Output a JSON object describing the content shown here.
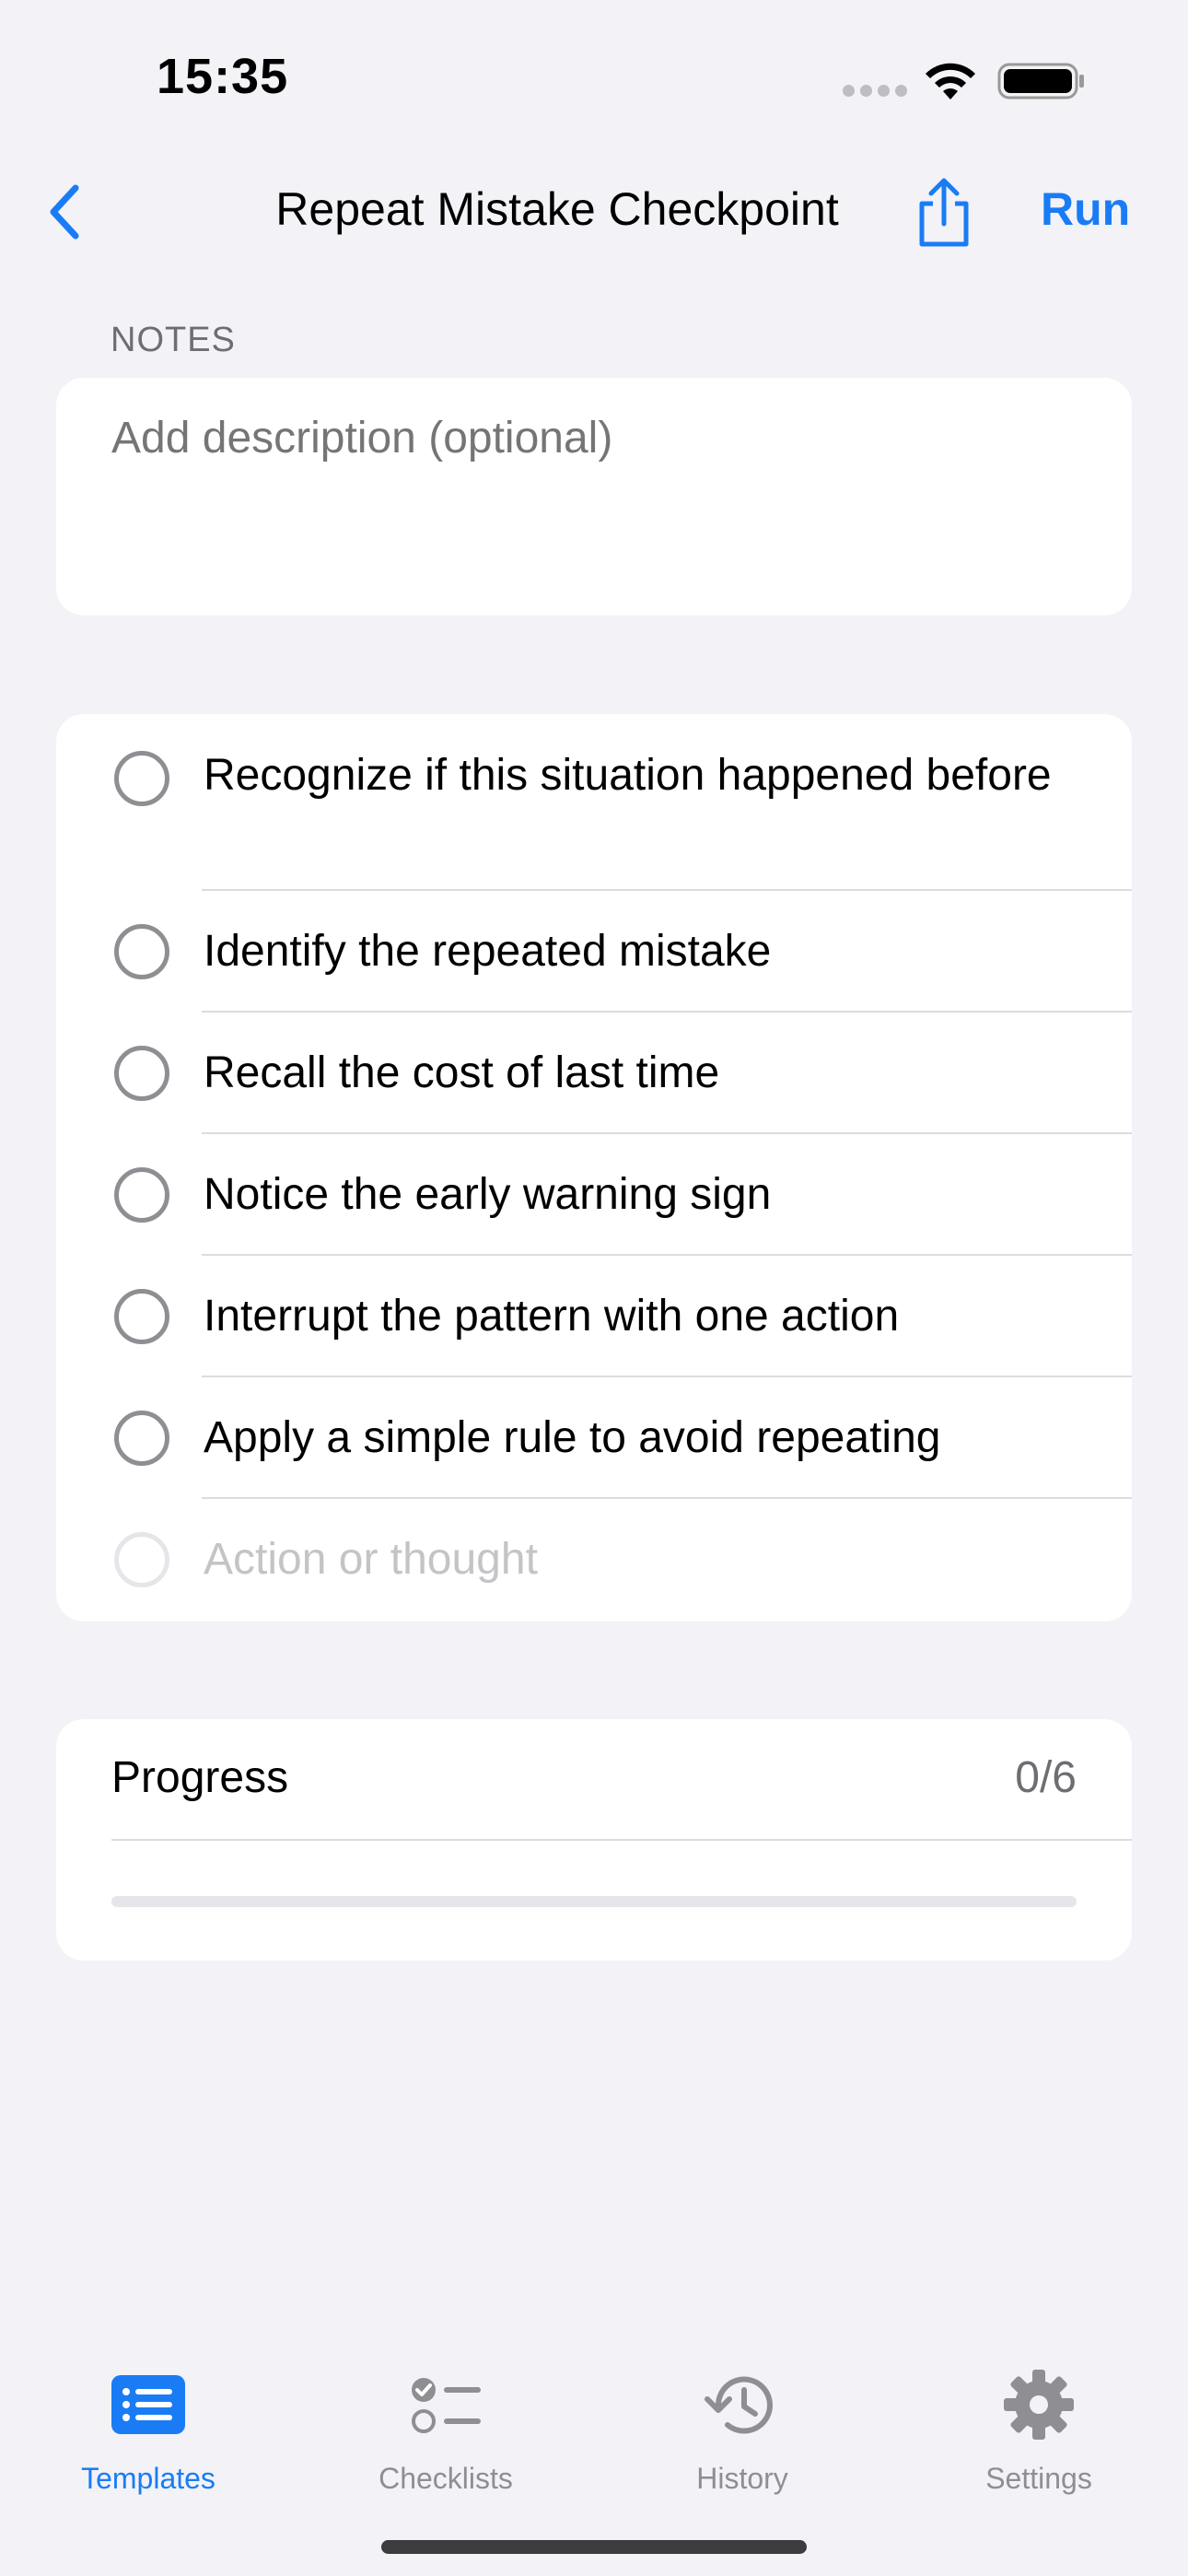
{
  "status_bar": {
    "time": "15:35"
  },
  "nav": {
    "title": "Repeat Mistake Checkpoint",
    "run_label": "Run",
    "back_icon": "chevron-left-icon",
    "share_icon": "share-icon"
  },
  "notes": {
    "header": "NOTES",
    "placeholder": "Add description (optional)",
    "value": ""
  },
  "checklist": {
    "items": [
      {
        "label": "Recognize if this situation happened before",
        "checked": false
      },
      {
        "label": "Identify the repeated mistake",
        "checked": false
      },
      {
        "label": "Recall the cost of last time",
        "checked": false
      },
      {
        "label": "Notice the early warning sign",
        "checked": false
      },
      {
        "label": "Interrupt the pattern with one action",
        "checked": false
      },
      {
        "label": "Apply a simple rule to avoid repeating",
        "checked": false
      }
    ],
    "new_item_placeholder": "Action or thought"
  },
  "progress": {
    "label": "Progress",
    "count": "0/6",
    "completed": 0,
    "total": 6
  },
  "tabs": [
    {
      "label": "Templates",
      "icon": "list-icon",
      "active": true
    },
    {
      "label": "Checklists",
      "icon": "checklist-icon",
      "active": false
    },
    {
      "label": "History",
      "icon": "history-icon",
      "active": false
    },
    {
      "label": "Settings",
      "icon": "gear-icon",
      "active": false
    }
  ],
  "colors": {
    "accent": "#1a7cf5",
    "background": "#f2f2f7",
    "secondary_text": "#6d6d72",
    "placeholder": "#c4c4c7"
  }
}
